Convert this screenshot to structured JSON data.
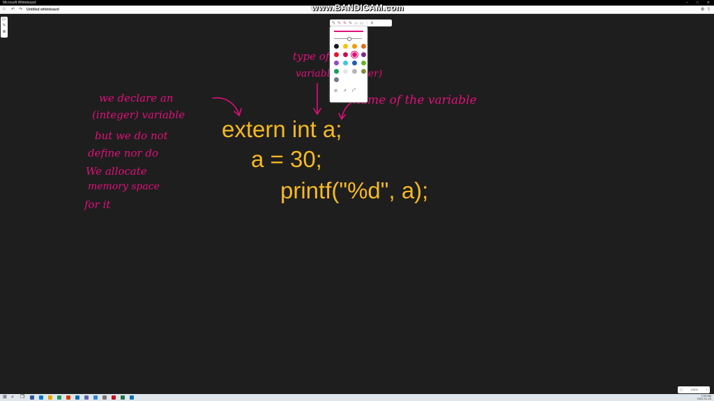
{
  "window": {
    "title": "Microsoft Whiteboard"
  },
  "toolbar": {
    "document_name": "Untitled whiteboard"
  },
  "watermark": "www.BANDICAM.com",
  "code": {
    "line1": "extern int a;",
    "line2": "a = 30;",
    "line3": "printf(\"%d\", a);"
  },
  "annotations": {
    "left": [
      "we declare an",
      "(integer) variable",
      "but we do not",
      "define nor do",
      "We allocate",
      "memory space",
      "for it"
    ],
    "type_label": "type of the",
    "type_label2": "variable (integer)",
    "name_label": "name of the variable"
  },
  "palette": {
    "colors": [
      "#1a1a1a",
      "#f5c400",
      "#f59a00",
      "#e36b1e",
      "#e3142d",
      "#c8104f",
      "#e0107a",
      "#7a2b8c",
      "#8e4fbf",
      "#3ec6e8",
      "#1f5fb0",
      "#6ab42d",
      "#1f9c5c",
      "#e6e6e6",
      "#b5b5b5",
      "#8a8a3a",
      "#6e7a8a"
    ],
    "selected_index": 6
  },
  "zoom": "100%",
  "tray": {
    "time": "7:53 AM",
    "date": "2022-01-15"
  },
  "taskbar_colors": [
    "#2b579a",
    "#0078d4",
    "#e8a400",
    "#1f9c5c",
    "#d83b01",
    "#0f6cbd",
    "#6264a7",
    "#2b88d8",
    "#7a7574",
    "#c50f1f",
    "#217346",
    "#106ebe"
  ]
}
